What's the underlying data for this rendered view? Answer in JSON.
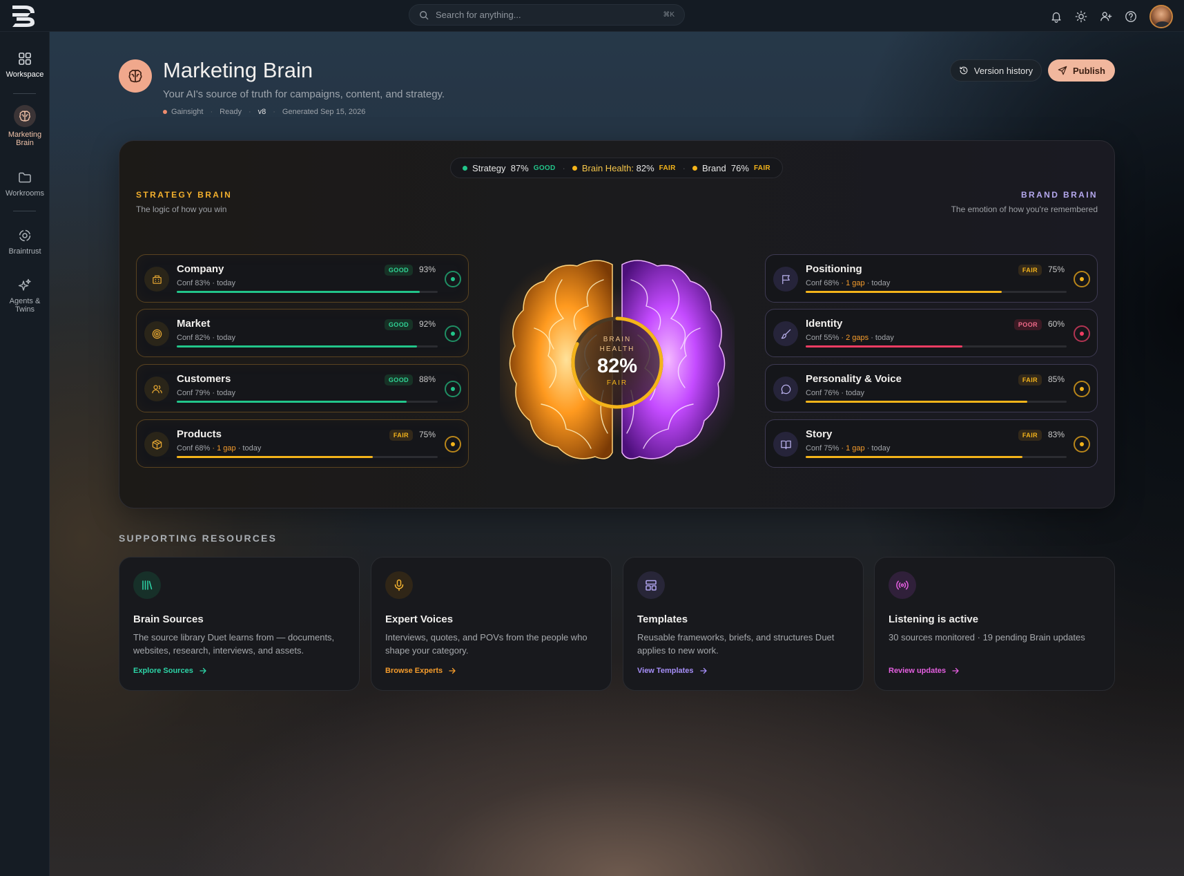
{
  "header": {
    "search_placeholder": "Search for anything...",
    "search_shortcut": "⌘K"
  },
  "sidebar": {
    "items": [
      {
        "label": "Workspace",
        "icon": "grid-icon"
      },
      {
        "label": "Marketing Brain",
        "icon": "brain-icon"
      },
      {
        "label": "Workrooms",
        "icon": "folder-icon"
      },
      {
        "label": "Braintrust",
        "icon": "braintrust-icon"
      },
      {
        "label": "Agents & Twins",
        "icon": "sparkles-icon"
      }
    ]
  },
  "page": {
    "title": "Marketing Brain",
    "subtitle": "Your AI's source of truth for campaigns, content, and strategy.",
    "meta": {
      "org": "Gainsight",
      "status": "Ready",
      "version": "v8",
      "generated": "Generated Sep 15, 2026"
    },
    "version_history_label": "Version history",
    "publish_label": "Publish"
  },
  "summary": {
    "strategy_label": "Strategy",
    "strategy_pct": "87%",
    "strategy_grade": "GOOD",
    "health_label": "Brain Health:",
    "health_pct": "82%",
    "health_grade": "FAIR",
    "brand_label": "Brand",
    "brand_pct": "76%",
    "brand_grade": "FAIR"
  },
  "strategy_brain": {
    "title": "STRATEGY BRAIN",
    "subtitle": "The logic of how you win",
    "items": [
      {
        "name": "Company",
        "conf": "Conf 83%",
        "gap": "",
        "when": "· today",
        "grade": "GOOD",
        "pct": "93%",
        "value": 93,
        "icon": "building-icon"
      },
      {
        "name": "Market",
        "conf": "Conf 82%",
        "gap": "",
        "when": "· today",
        "grade": "GOOD",
        "pct": "92%",
        "value": 92,
        "icon": "target-icon"
      },
      {
        "name": "Customers",
        "conf": "Conf 79%",
        "gap": "",
        "when": "· today",
        "grade": "GOOD",
        "pct": "88%",
        "value": 88,
        "icon": "users-icon"
      },
      {
        "name": "Products",
        "conf": "Conf 68%",
        "gap": "· 1 gap",
        "when": "· today",
        "grade": "FAIR",
        "pct": "75%",
        "value": 75,
        "icon": "box-icon"
      }
    ]
  },
  "brand_brain": {
    "title": "BRAND BRAIN",
    "subtitle": "The emotion of how you're remembered",
    "items": [
      {
        "name": "Positioning",
        "conf": "Conf 68%",
        "gap": "· 1 gap",
        "when": "· today",
        "grade": "FAIR",
        "pct": "75%",
        "value": 75,
        "icon": "flag-icon"
      },
      {
        "name": "Identity",
        "conf": "Conf 55%",
        "gap": "· 2 gaps",
        "when": "· today",
        "grade": "POOR",
        "pct": "60%",
        "value": 60,
        "icon": "brush-icon"
      },
      {
        "name": "Personality & Voice",
        "conf": "Conf 76%",
        "gap": "",
        "when": "· today",
        "grade": "FAIR",
        "pct": "85%",
        "value": 85,
        "icon": "chat-icon"
      },
      {
        "name": "Story",
        "conf": "Conf 75%",
        "gap": "· 1 gap",
        "when": "· today",
        "grade": "FAIR",
        "pct": "83%",
        "value": 83,
        "icon": "book-icon"
      }
    ]
  },
  "brain_health": {
    "line1": "BRAIN",
    "line2": "HEALTH",
    "pct": "82%",
    "grade": "FAIR",
    "value": 82
  },
  "resources": {
    "title": "SUPPORTING RESOURCES",
    "items": [
      {
        "title": "Brain Sources",
        "desc": "The source library Duet learns from — documents, websites, research, interviews, and assets.",
        "link": "Explore Sources",
        "icon": "library-icon",
        "color": "#2dd4a7"
      },
      {
        "title": "Expert Voices",
        "desc": "Interviews, quotes, and POVs from the people who shape your category.",
        "link": "Browse Experts",
        "icon": "mic-icon",
        "color": "#f59c2c"
      },
      {
        "title": "Templates",
        "desc": "Reusable frameworks, briefs, and structures Duet applies to new work.",
        "link": "View Templates",
        "icon": "layout-icon",
        "color": "#a58ef7"
      },
      {
        "title": "Listening is active",
        "desc": "30 sources monitored · 19 pending Brain updates",
        "link": "Review updates",
        "icon": "broadcast-icon",
        "color": "#e45fe0"
      }
    ]
  },
  "colors": {
    "good": "#22c58a",
    "fair": "#f4b41a",
    "poor": "#f03c63",
    "strategy_accent": "#f3b02d",
    "brand_accent": "#b5a8ee",
    "publish_bg": "#f1b79d",
    "brain_left": "#ff9a1f",
    "brain_right": "#c44bff"
  }
}
